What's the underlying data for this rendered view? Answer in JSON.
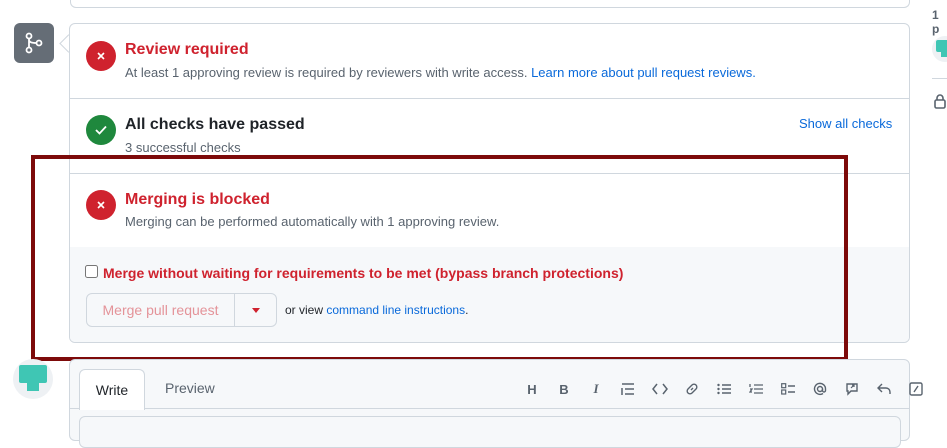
{
  "merge_box": {
    "review": {
      "title": "Review required",
      "description": "At least 1 approving review is required by reviewers with write access.",
      "link": "Learn more about pull request reviews."
    },
    "checks": {
      "title": "All checks have passed",
      "description": "3 successful checks",
      "show_all": "Show all checks"
    },
    "blocked": {
      "title": "Merging is blocked",
      "description": "Merging can be performed automatically with 1 approving review."
    },
    "bypass_label": "Merge without waiting for requirements to be met (bypass branch protections)",
    "merge_button": "Merge pull request",
    "or_view": "or view",
    "cli_link": "command line instructions",
    "period": "."
  },
  "comment": {
    "tabs": [
      "Write",
      "Preview"
    ],
    "toolbar_icons": [
      "heading-icon",
      "bold-icon",
      "italic-icon",
      "quote-icon",
      "code-icon",
      "link-icon",
      "unordered-list-icon",
      "ordered-list-icon",
      "task-list-icon",
      "mention-icon",
      "reference-icon",
      "reply-icon",
      "slash-command-icon"
    ]
  },
  "sidebar": {
    "participants_partial": "1 p"
  },
  "colors": {
    "fail": "#cf222e",
    "pass": "#1f883d",
    "link": "#0969da",
    "highlight": "#7d0a0a",
    "avatar": "#3fc6b4"
  }
}
